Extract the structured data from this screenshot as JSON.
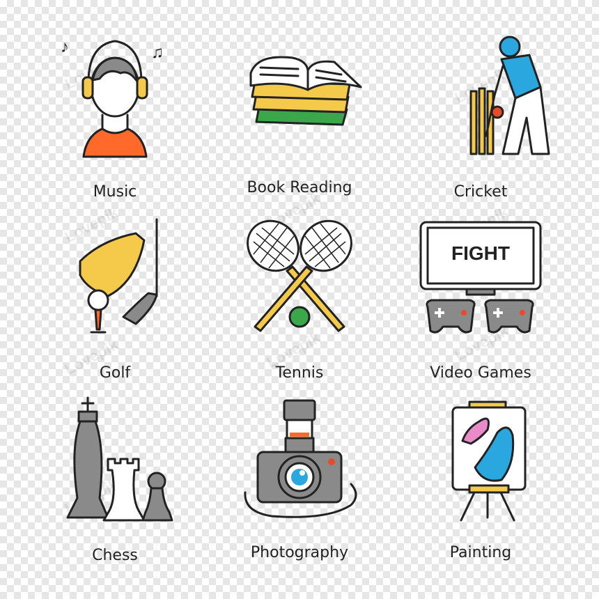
{
  "items": [
    {
      "label": "Music"
    },
    {
      "label": "Book Reading"
    },
    {
      "label": "Cricket"
    },
    {
      "label": "Golf"
    },
    {
      "label": "Tennis"
    },
    {
      "label": "Video Games"
    },
    {
      "label": "Chess"
    },
    {
      "label": "Photography"
    },
    {
      "label": "Painting"
    }
  ],
  "screen_text": "FIGHT",
  "watermark": "Lovepik",
  "colors": {
    "ink": "#222222",
    "orange": "#ff6a2b",
    "yellow": "#f5c94a",
    "blue": "#2aa7de",
    "green": "#3aa84a",
    "red": "#e84a2a",
    "pink": "#e98bc8",
    "grey": "#8a8a8a"
  }
}
